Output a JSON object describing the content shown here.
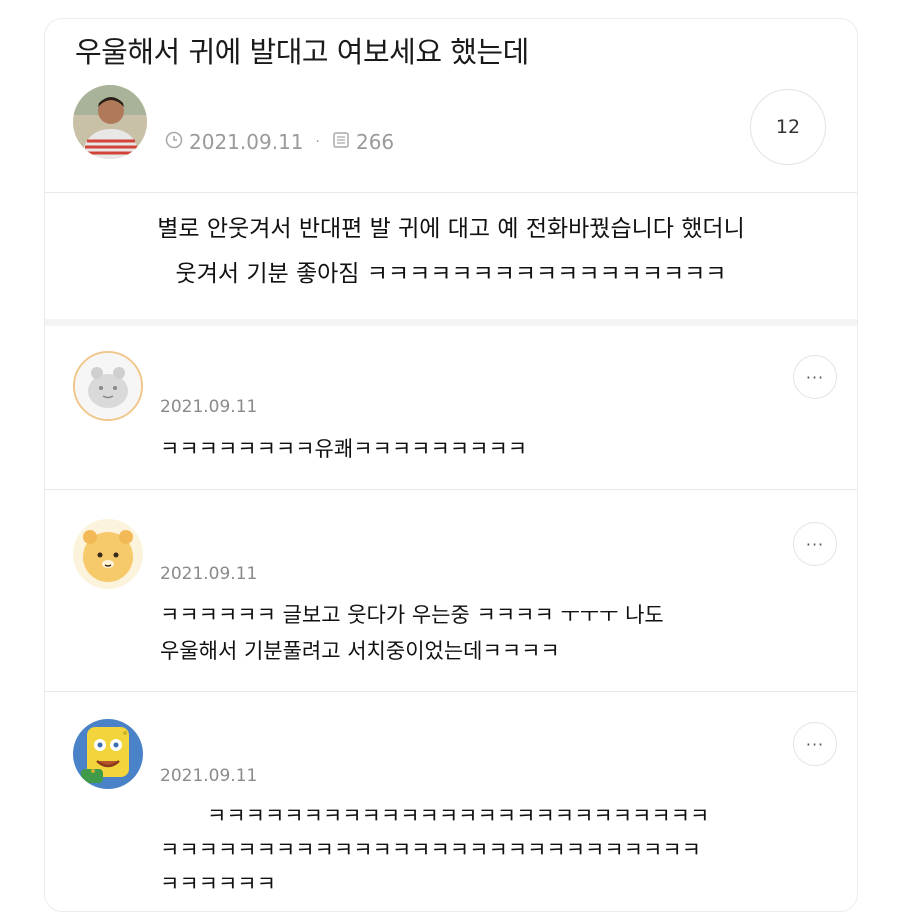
{
  "post": {
    "title": "우울해서 귀에 발대고 여보세요 했는데",
    "date": "2021.09.11",
    "views": "266",
    "comment_count": "12",
    "body_line1": "별로 안웃겨서 반대편 발 귀에 대고 예 전화바꿨습니다 했더니",
    "body_line2": "웃겨서 기분 좋아짐 ㅋㅋㅋㅋㅋㅋㅋㅋㅋㅋㅋㅋㅋㅋㅋㅋㅋ"
  },
  "comments": [
    {
      "date": "2021.09.11",
      "lines": [
        "ㅋㅋㅋㅋㅋㅋㅋㅋ유쾌ㅋㅋㅋㅋㅋㅋㅋㅋㅋ"
      ]
    },
    {
      "date": "2021.09.11",
      "lines": [
        "ㅋㅋㅋㅋㅋㅋ 글보고 웃다가 우는중 ㅋㅋㅋㅋ ㅜㅜㅜ 나도",
        "우울해서 기분풀려고 서치중이었는데ㅋㅋㅋㅋ"
      ]
    },
    {
      "date": "2021.09.11",
      "lines": [
        "ㅋㅋㅋㅋㅋㅋㅋㅋㅋㅋㅋㅋㅋㅋㅋㅋㅋㅋㅋㅋㅋㅋㅋㅋㅋㅋ",
        "ㅋㅋㅋㅋㅋㅋㅋㅋㅋㅋㅋㅋㅋㅋㅋㅋㅋㅋㅋㅋㅋㅋㅋㅋㅋㅋㅋㅋ",
        "ㅋㅋㅋㅋㅋㅋ"
      ]
    }
  ],
  "ui": {
    "more_label": "···"
  }
}
